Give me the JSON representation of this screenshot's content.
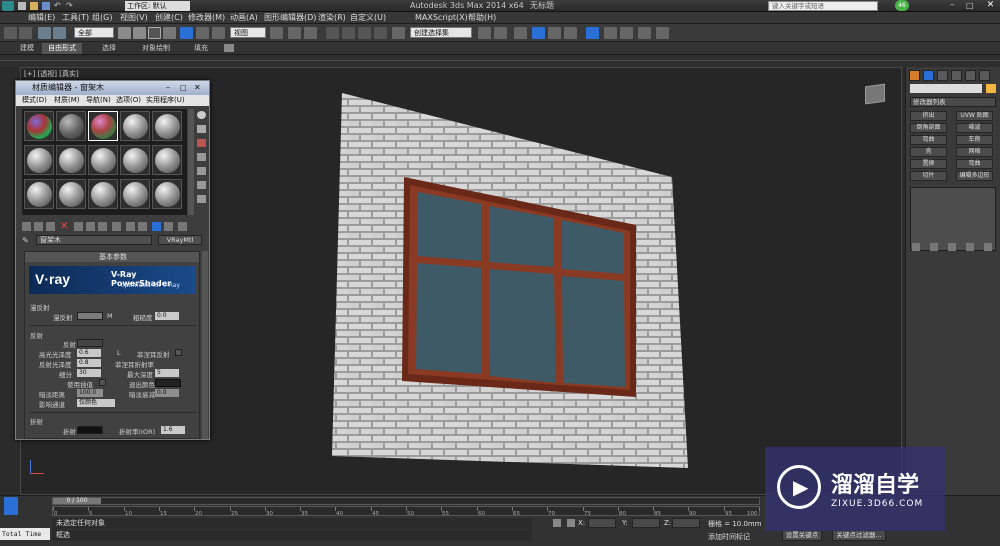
{
  "titlebar": {
    "workspace": "工作区: 默认",
    "app_title": "Autodesk 3ds Max  2014 x64",
    "file_title": "无标题",
    "search_placeholder": "键入关键字或短语",
    "badge": "46"
  },
  "menubar": {
    "items": [
      "编辑(E)",
      "工具(T)",
      "组(G)",
      "视图(V)",
      "创建(C)",
      "修改器(M)",
      "动画(A)",
      "图形编辑器(D)",
      "渲染(R)",
      "自定义(U)",
      "MAXScript(X)",
      "帮助(H)"
    ]
  },
  "toolbar": {
    "filter_value": "全部",
    "refcoord_value": "视图",
    "selection_set_value": "创建选择集"
  },
  "ribbon": {
    "tabs": [
      "建模",
      "自由形式",
      "选择",
      "对象绘制",
      "填充"
    ],
    "active_tab": "自由形式"
  },
  "viewport": {
    "label": "[+] [透视] [真实]"
  },
  "command_panel": {
    "modifier_list": "修改器列表",
    "buttons": [
      "挤出",
      "UVW 贴图",
      "倒角剖面",
      "噪波",
      "弯曲",
      "车削",
      "壳",
      "网格",
      "置换",
      "弯曲",
      "切片",
      "编辑多边形"
    ]
  },
  "material_editor": {
    "title": "材质编辑器 - 窗架木",
    "menu": [
      "模式(D)",
      "材质(M)",
      "导航(N)",
      "选项(O)",
      "实用程序(U)"
    ],
    "material_name": "窗架木",
    "material_type": "VRayMtl",
    "rollout_title": "基本参数",
    "banner_brand": "V·ray",
    "banner_title": "V-Ray PowerShader",
    "banner_subtitle": "optimized for V-Ray",
    "diffuse_section": "漫反射",
    "diffuse_label": "漫反射",
    "diffuse_map_btn": "M",
    "roughness_label": "粗糙度",
    "roughness_value": "0.0",
    "reflection_section": "反射",
    "reflect_label": "反射",
    "hilight_gloss_label": "高光光泽度",
    "hilight_gloss_value": "0.6",
    "l_btn": "L",
    "fresnel_label": "菲涅耳反射",
    "refl_gloss_label": "反射光泽度",
    "refl_gloss_value": "0.8",
    "fresnel_ior_label": "菲涅耳折射率",
    "subdivs_label": "细分",
    "subdivs_value": "30",
    "max_depth_label": "最大深度",
    "max_depth_value": "5",
    "use_interp_label": "使用插值",
    "exit_color_label": "退出颜色",
    "dim_distance_label": "暗淡距离",
    "dim_distance_value": "100.0",
    "dim_falloff_label": "暗淡衰减",
    "dim_falloff_value": "0.0",
    "affect_channels_label": "影响通道",
    "affect_channels_value": "仅颜色",
    "refraction_section": "折射",
    "refract_label": "折射",
    "ior_label": "折射率(IOR)",
    "ior_value": "1.6"
  },
  "bottom": {
    "frame_counter": "0 / 100",
    "ticks": [
      "0",
      "5",
      "10",
      "15",
      "20",
      "25",
      "30",
      "35",
      "40",
      "45",
      "50",
      "55",
      "60",
      "65",
      "70",
      "75",
      "80",
      "85",
      "90",
      "95",
      "100"
    ],
    "status_text": "未选定任何对象",
    "prompt_text": "框选",
    "x_label": "X:",
    "y_label": "Y:",
    "z_label": "Z:",
    "grid_label": "栅格 = 10.0mm",
    "add_time_tag": "添加时间标记",
    "set_key": "设置关键点",
    "key_filters": "关键点过滤器...",
    "total_time": "Total Time"
  },
  "watermark": {
    "brand_cn": "溜溜自学",
    "brand_url": "ZIXUE.3D66.COM"
  },
  "colors": {
    "accent_orange": "#d77d2a",
    "selection_blue": "#2a6fd6",
    "wall_light": "#c9c9c9",
    "window_frame": "#7a2f1c",
    "glass": "#3e5a66"
  }
}
